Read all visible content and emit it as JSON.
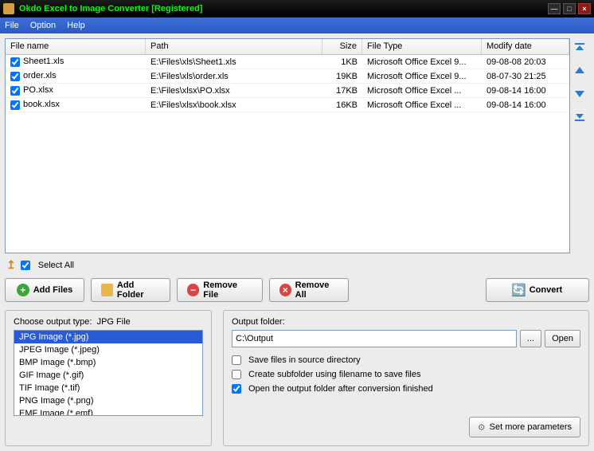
{
  "title": "Okdo Excel to Image Converter [Registered]",
  "menu": {
    "file": "File",
    "option": "Option",
    "help": "Help"
  },
  "columns": {
    "name": "File name",
    "path": "Path",
    "size": "Size",
    "type": "File Type",
    "date": "Modify date"
  },
  "files": [
    {
      "checked": true,
      "name": "Sheet1.xls",
      "path": "E:\\Files\\xls\\Sheet1.xls",
      "size": "1KB",
      "type": "Microsoft Office Excel 9...",
      "date": "09-08-08 20:03"
    },
    {
      "checked": true,
      "name": "order.xls",
      "path": "E:\\Files\\xls\\order.xls",
      "size": "19KB",
      "type": "Microsoft Office Excel 9...",
      "date": "08-07-30 21:25"
    },
    {
      "checked": true,
      "name": "PO.xlsx",
      "path": "E:\\Files\\xlsx\\PO.xlsx",
      "size": "17KB",
      "type": "Microsoft Office Excel ...",
      "date": "09-08-14 16:00"
    },
    {
      "checked": true,
      "name": "book.xlsx",
      "path": "E:\\Files\\xlsx\\book.xlsx",
      "size": "16KB",
      "type": "Microsoft Office Excel ...",
      "date": "09-08-14 16:00"
    }
  ],
  "select_all": {
    "label": "Select All",
    "checked": true
  },
  "buttons": {
    "add_files": "Add Files",
    "add_folder": "Add Folder",
    "remove_file": "Remove File",
    "remove_all": "Remove All",
    "convert": "Convert",
    "browse": "...",
    "open": "Open",
    "more_params": "Set more parameters"
  },
  "output_type": {
    "label": "Choose output type:",
    "current": "JPG File",
    "items": [
      "JPG Image (*.jpg)",
      "JPEG Image (*.jpeg)",
      "BMP Image (*.bmp)",
      "GIF Image (*.gif)",
      "TIF Image (*.tif)",
      "PNG Image (*.png)",
      "EMF Image (*.emf)"
    ],
    "selected_index": 0
  },
  "output_folder": {
    "label": "Output folder:",
    "value": "C:\\Output",
    "save_source": {
      "label": "Save files in source directory",
      "checked": false
    },
    "subfolder": {
      "label": "Create subfolder using filename to save files",
      "checked": false
    },
    "open_after": {
      "label": "Open the output folder after conversion finished",
      "checked": true
    }
  }
}
